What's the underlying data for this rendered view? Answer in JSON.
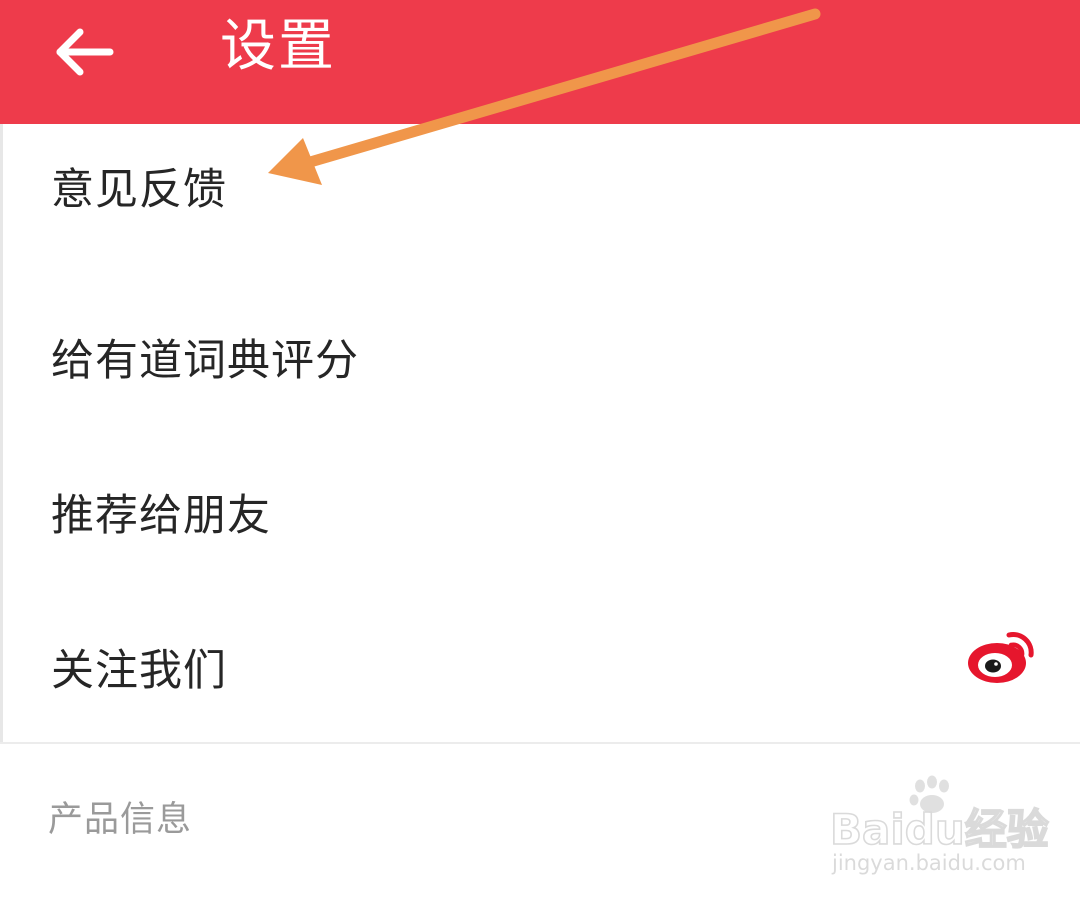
{
  "header": {
    "title": "设置",
    "background_color": "#ee3b4b",
    "back_icon": "arrow-left-icon"
  },
  "settings": {
    "items": [
      {
        "label": "意见反馈"
      },
      {
        "label": "给有道词典评分"
      },
      {
        "label": "推荐给朋友"
      },
      {
        "label": "关注我们",
        "icon": "weibo-icon"
      }
    ]
  },
  "section": {
    "product_info_label": "产品信息"
  },
  "annotation": {
    "arrow_color": "#f0964a"
  },
  "watermark": {
    "brand": "Baidu经验",
    "url": "jingyan.baidu.com"
  }
}
